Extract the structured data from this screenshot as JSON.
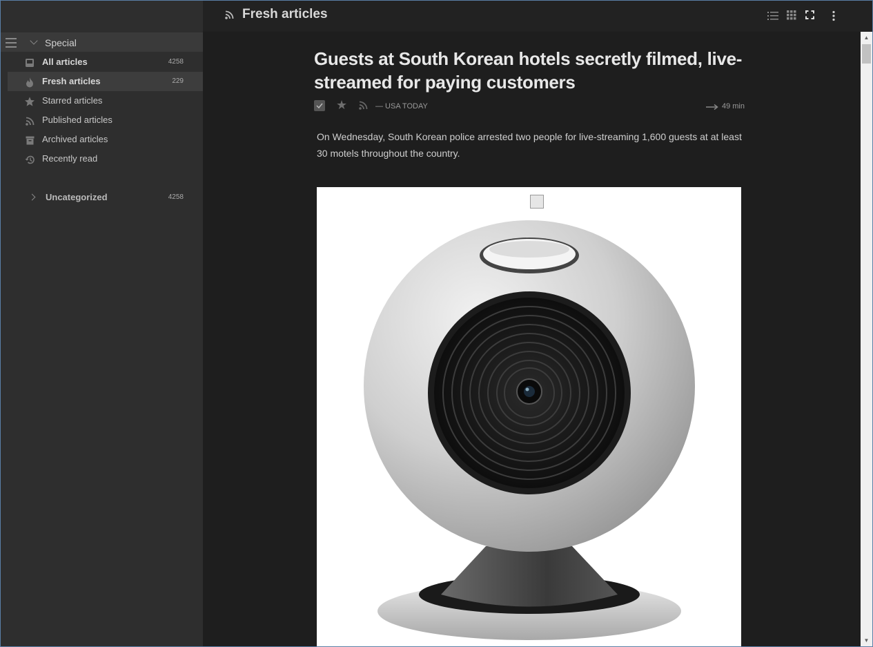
{
  "header": {
    "feed_title": "Fresh articles",
    "buttons": [
      "list-view-icon",
      "grid-view-icon",
      "fullscreen-icon",
      "more-vert-icon"
    ]
  },
  "sidebar": {
    "special_label": "Special",
    "items": [
      {
        "label": "All articles",
        "count": "4258",
        "icon": "inbox-icon",
        "bold": true
      },
      {
        "label": "Fresh articles",
        "count": "229",
        "icon": "fire-icon",
        "bold": true,
        "active": true
      },
      {
        "label": "Starred articles",
        "count": "",
        "icon": "star-icon"
      },
      {
        "label": "Published articles",
        "count": "",
        "icon": "rss-icon"
      },
      {
        "label": "Archived articles",
        "count": "",
        "icon": "archive-icon"
      },
      {
        "label": "Recently read",
        "count": "",
        "icon": "history-icon"
      }
    ],
    "category": {
      "label": "Uncategorized",
      "count": "4258"
    }
  },
  "article": {
    "title": "Guests at South Korean hotels secretly filmed, live-streamed for paying customers",
    "source": "— USA TODAY",
    "read_time": "49 min",
    "summary": "On Wednesday, South Korean police arrested two people for live-streaming 1,600 guests at at least 30 motels throughout the country."
  },
  "colors": {
    "sidebar_bg": "#2e2e2e",
    "content_bg": "#1e1e1e",
    "active_item_bg": "#3d3d3d"
  }
}
